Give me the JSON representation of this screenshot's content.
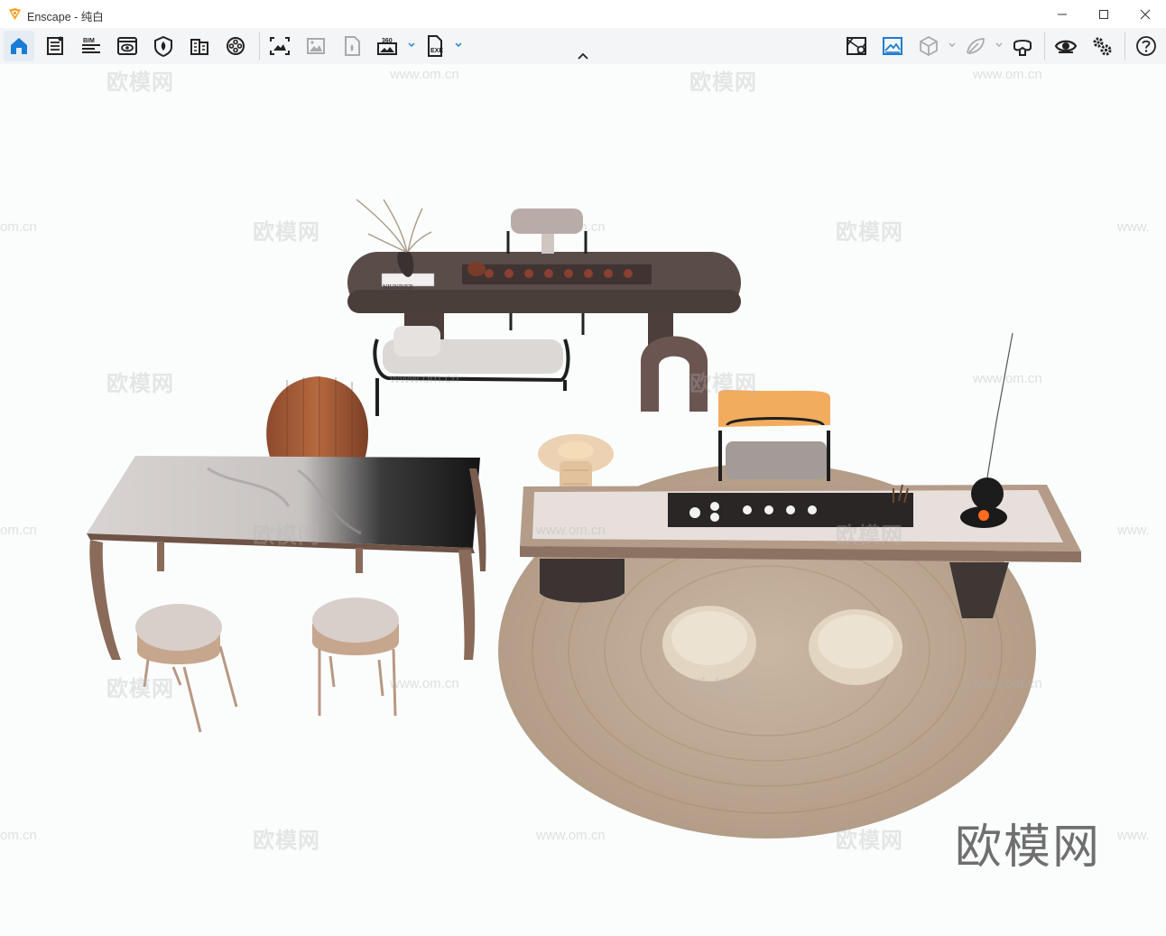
{
  "window": {
    "app_name": "Enscape",
    "title": "Enscape - 纯白"
  },
  "window_controls": {
    "minimize_icon": "minimize-icon",
    "maximize_icon": "maximize-icon",
    "close_icon": "close-icon"
  },
  "toolbar": {
    "left_group": [
      {
        "icon": "home-icon"
      },
      {
        "icon": "document-list-icon"
      },
      {
        "icon": "bim-icon",
        "label": "BIM"
      },
      {
        "icon": "view-eye-icon"
      },
      {
        "icon": "shield-leaf-icon"
      },
      {
        "icon": "building-icon"
      },
      {
        "icon": "film-reel-icon"
      }
    ],
    "capture_group": [
      {
        "icon": "screenshot-icon"
      },
      {
        "icon": "batch-render-icon"
      },
      {
        "icon": "panorama-file-icon"
      },
      {
        "icon": "panorama-360-icon",
        "label": "360"
      },
      {
        "icon": "export-exe-icon",
        "label": "EXE"
      }
    ],
    "right_group": [
      {
        "icon": "map-view-icon"
      },
      {
        "icon": "visual-settings-icon"
      },
      {
        "icon": "cube-icon"
      },
      {
        "icon": "asset-library-icon"
      },
      {
        "icon": "vr-headset-icon"
      },
      {
        "icon": "live-view-eye-icon"
      },
      {
        "icon": "settings-gears-icon"
      },
      {
        "icon": "help-icon"
      }
    ]
  },
  "viewport": {
    "watermark_text": "欧模网",
    "watermark_url": "www.om.cn",
    "watermark_url_fragment": "om.cn",
    "watermark_url_start": "www.",
    "brand_mark": "欧模网",
    "book_title": "NIUNIVER"
  },
  "colors": {
    "accent_blue": "#1a7cd4",
    "toolbar_bg": "#f4f5f6",
    "logo_orange": "#f29b1d",
    "viewport_bg": "#fbfdfd"
  }
}
